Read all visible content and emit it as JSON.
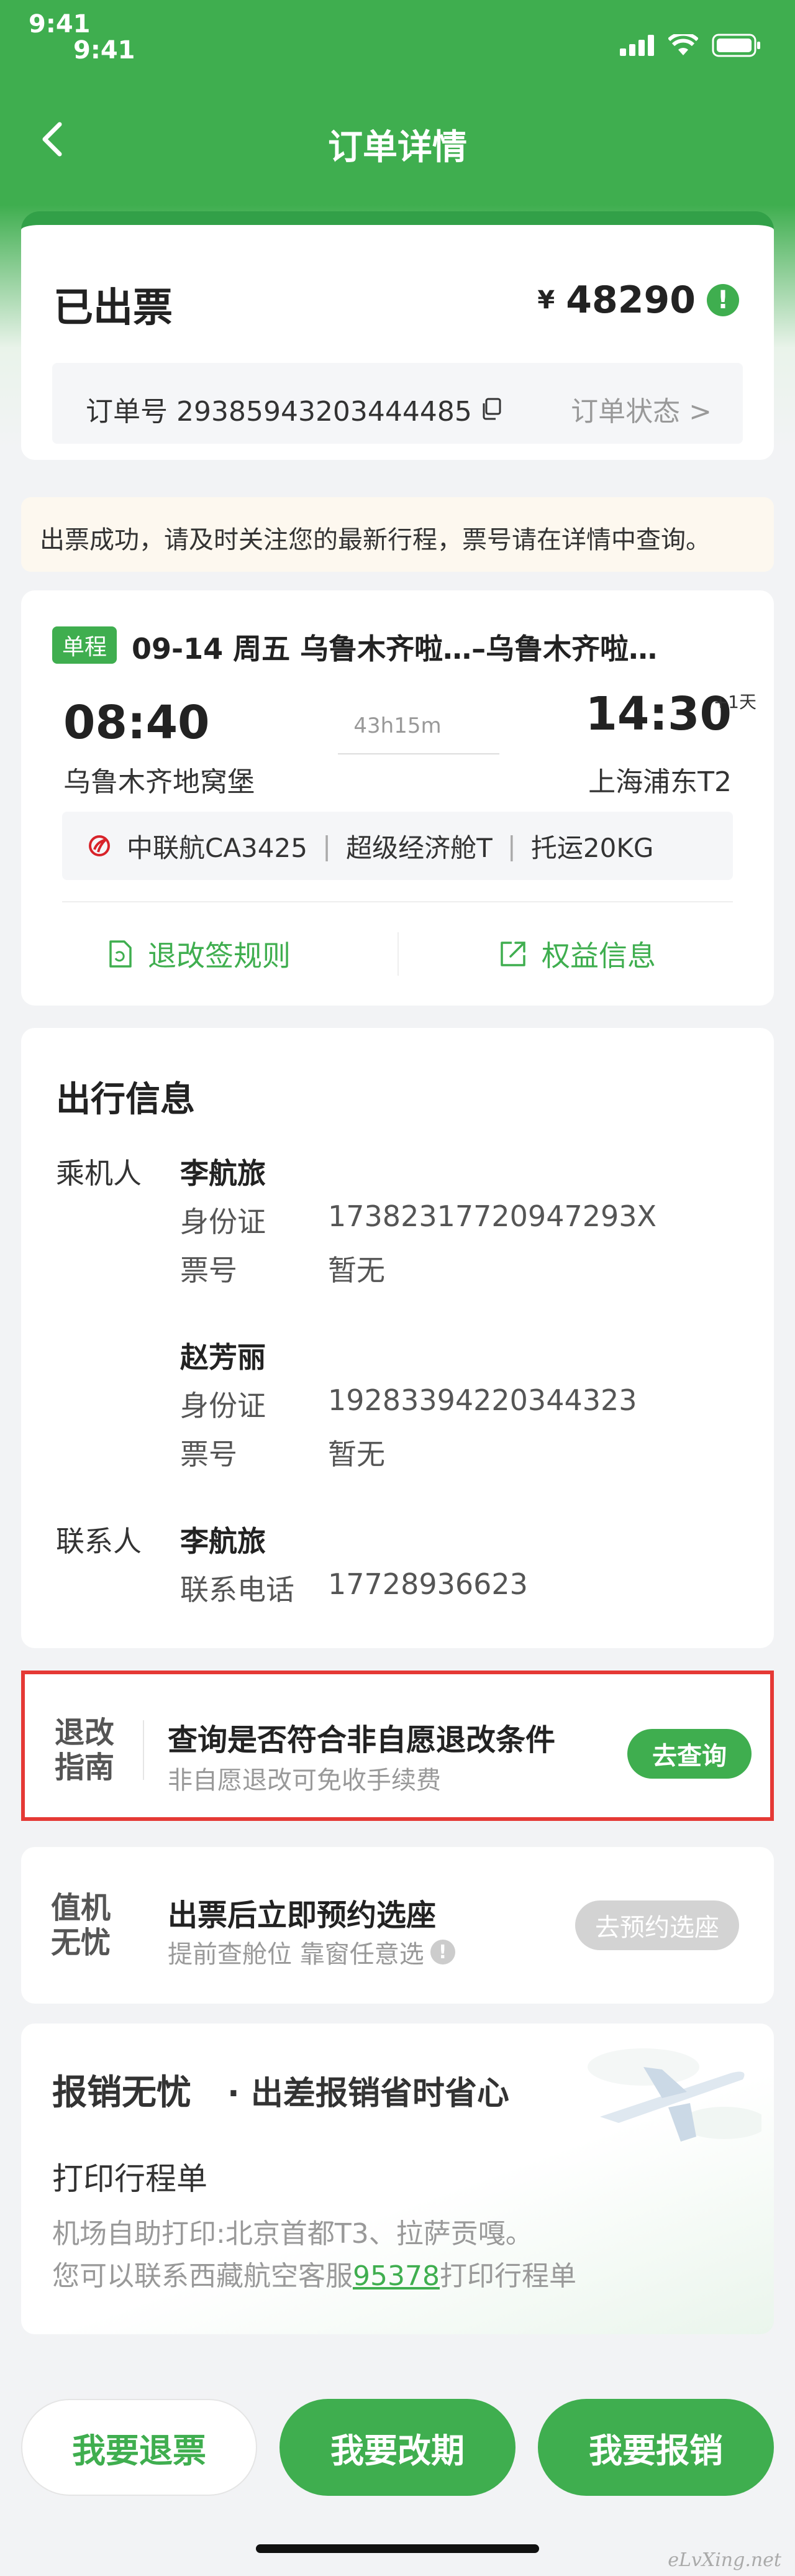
{
  "status_bar": {
    "time_primary": "9:41",
    "time_secondary": "9:41"
  },
  "nav": {
    "title": "订单详情"
  },
  "order": {
    "status": "已出票",
    "currency": "¥",
    "price": "48290",
    "order_no": "订单号 29385943203444485",
    "order_status_link": "订单状态 >"
  },
  "notice": {
    "text": "出票成功，请及时关注您的最新行程，票号请在详情中查询。"
  },
  "flight": {
    "trip_type": "单程",
    "route_line": "09-14 周五 乌鲁木齐啦…–乌鲁木齐啦…",
    "dep_time": "08:40",
    "arr_time": "14:30",
    "plus_day": "+1天",
    "duration": "43h15m",
    "dep_airport": "乌鲁木齐地窝堡",
    "arr_airport": "上海浦东T2",
    "airline": "中联航CA3425",
    "cabin": "超级经济舱T",
    "baggage": "托运20KG",
    "rules_link": "退改签规则",
    "benefits_link": "权益信息"
  },
  "travel": {
    "title": "出行信息",
    "passenger_label": "乘机人",
    "contact_label": "联系人",
    "passengers": [
      {
        "name": "李航旅",
        "id_label": "身份证",
        "id_value": "17382317720947293X",
        "ticket_label": "票号",
        "ticket_value": "暂无"
      },
      {
        "name": "赵芳丽",
        "id_label": "身份证",
        "id_value": "19283394220344323",
        "ticket_label": "票号",
        "ticket_value": "暂无"
      }
    ],
    "contact": {
      "name": "李航旅",
      "phone_label": "联系电话",
      "phone_value": "17728936623"
    }
  },
  "refund_guide": {
    "logo_line1": "退改",
    "logo_line2": "指南",
    "title": "查询是否符合非自愿退改条件",
    "subtitle": "非自愿退改可免收手续费",
    "button": "去查询"
  },
  "seat": {
    "logo_line1": "值机",
    "logo_line2": "无忧",
    "title": "出票后立即预约选座",
    "subtitle": "提前查舱位 靠窗任意选",
    "button": "去预约选座"
  },
  "expense": {
    "brand": "报销无忧",
    "slogan": "· 出差报销省时省心",
    "title": "打印行程单",
    "line1": "机场自助打印:北京首都T3、拉萨贡嘎。",
    "line2_prefix": "您可以联系西藏航空客服",
    "line2_phone": "95378",
    "line2_suffix": "打印行程单"
  },
  "actions": {
    "refund": "我要退票",
    "change": "我要改期",
    "reimburse": "我要报销"
  },
  "watermark": "eLvXing.net",
  "colors": {
    "brand_green": "#3fae4f",
    "highlight_red": "#e53935",
    "airline_red": "#d8232a"
  }
}
